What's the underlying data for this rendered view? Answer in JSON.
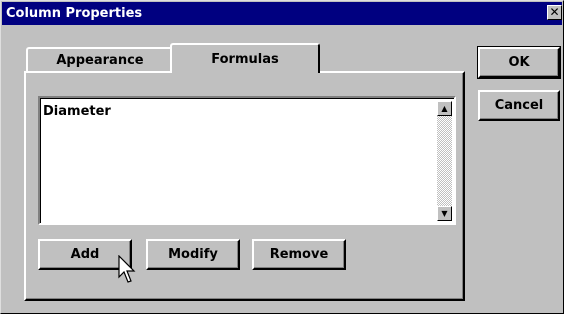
{
  "window": {
    "title": "Column Properties",
    "close_glyph": "✕"
  },
  "tabs": [
    {
      "label": "Appearance",
      "active": false
    },
    {
      "label": "Formulas",
      "active": true
    }
  ],
  "formulas_list": {
    "items": [
      "Diameter"
    ]
  },
  "panel_buttons": {
    "add": "Add",
    "modify": "Modify",
    "remove": "Remove"
  },
  "dialog_buttons": {
    "ok": "OK",
    "cancel": "Cancel"
  },
  "icons": {
    "scroll_up": "scroll-up-icon",
    "scroll_down": "scroll-down-icon",
    "cursor": "mouse-pointer-icon"
  },
  "colors": {
    "titlebar": "#000080",
    "face": "#c0c0c0"
  }
}
